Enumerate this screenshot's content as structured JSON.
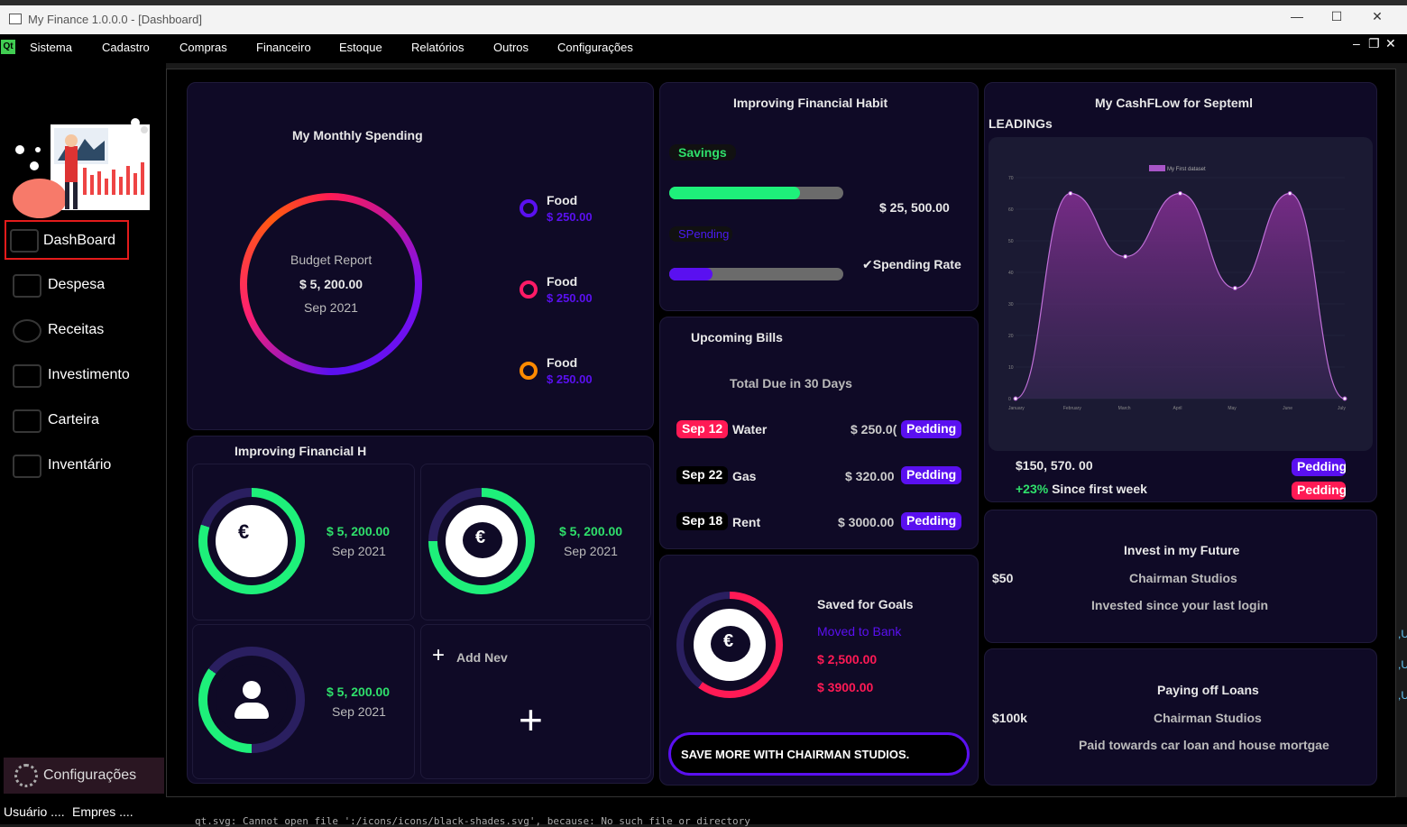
{
  "window": {
    "title": "My Finance 1.0.0.0 - [Dashboard]",
    "min": "—",
    "max": "☐",
    "close": "✕"
  },
  "menu": {
    "qt_badge": "Qt",
    "items": [
      "Sistema",
      "Cadastro",
      "Compras",
      "Financeiro",
      "Estoque",
      "Relatórios",
      "Outros",
      "Configurações"
    ],
    "mdi_buttons": [
      "–",
      "❐",
      "✕"
    ]
  },
  "sidebar": {
    "items": [
      {
        "label": "DashBoard",
        "icon": "dashboard-icon"
      },
      {
        "label": "Despesa",
        "icon": "expense-icon"
      },
      {
        "label": "Receitas",
        "icon": "income-icon"
      },
      {
        "label": "Investimento",
        "icon": "investment-icon"
      },
      {
        "label": "Carteira",
        "icon": "wallet-icon"
      },
      {
        "label": "Inventário",
        "icon": "inventory-icon"
      }
    ],
    "config_label": "Configurações"
  },
  "status": {
    "user": "Usuário ....",
    "company": "Empres ....",
    "console": "qt.svg: Cannot open file ':/icons/icons/black-shades.svg', because: No such file or directory"
  },
  "monthly_spending": {
    "title": "My Monthly Spending",
    "center_title": "Budget Report",
    "center_amount": "$ 5, 200.00",
    "center_date": "Sep 2021",
    "legend": [
      {
        "label": "Food",
        "amount": "$ 250.00",
        "color": "#5a10f0"
      },
      {
        "label": "Food",
        "amount": "$ 250.00",
        "color": "#ff1a66"
      },
      {
        "label": "Food",
        "amount": "$ 250.00",
        "color": "#ff8a00"
      }
    ]
  },
  "habit": {
    "title": "Improving Financial Habit",
    "savings_label": "Savings",
    "savings_progress": 0.75,
    "savings_amount": "$ 25, 500.00",
    "spending_label": "SPending",
    "spending_progress": 0.25,
    "spending_rate": "✔Spending Rate"
  },
  "cashflow": {
    "title": "My CashFLow for Septeml",
    "subtitle": "LEADINGs",
    "amount": "$150, 570. 00",
    "growth": "+23%",
    "growth_text": " Since first week",
    "badge1": "Pedding",
    "badge2": "Pedding"
  },
  "chart_data": {
    "type": "area",
    "legend": "My First dataset",
    "x": [
      "January",
      "February",
      "March",
      "April",
      "May",
      "June",
      "July"
    ],
    "series": [
      {
        "name": "My First dataset",
        "values": [
          0,
          65,
          45,
          65,
          35,
          65,
          0
        ]
      }
    ],
    "ylim": [
      0,
      70
    ],
    "yticks": [
      0,
      10,
      20,
      30,
      40,
      50,
      60,
      70
    ],
    "color": "#a855c7"
  },
  "improving_h": {
    "title": "Improving Financial H",
    "cards": [
      {
        "amount": "$ 5, 200.00",
        "date": "Sep 2021",
        "icon": "euro-hand-icon",
        "progress": 0.8
      },
      {
        "amount": "$ 5, 200.00",
        "date": "Sep 2021",
        "icon": "money-bag-icon",
        "progress": 0.75
      },
      {
        "amount": "$ 5, 200.00",
        "date": "Sep 2021",
        "icon": "user-icon",
        "progress": 0.35
      }
    ],
    "add_label": "Add Nev"
  },
  "bills": {
    "title": "Upcoming Bills",
    "subtitle": "Total Due in 30 Days",
    "items": [
      {
        "date": "Sep 12",
        "name": "Water",
        "amount": "$ 250.0(",
        "status": "Pedding",
        "date_color": "#ff1a55"
      },
      {
        "date": "Sep 22",
        "name": "Gas",
        "amount": "$ 320.00",
        "status": "Pedding",
        "date_color": "#000000"
      },
      {
        "date": "Sep 18",
        "name": "Rent",
        "amount": "$ 3000.00",
        "status": "Pedding",
        "date_color": "#000000"
      }
    ]
  },
  "goals": {
    "title": "Saved for Goals",
    "moved": "Moved to Bank",
    "amount1": "$ 2,500.00",
    "amount2": "$ 3900.00",
    "progress": 0.6,
    "cta": "SAVE MORE WITH CHAIRMAN STUDIOS."
  },
  "invest": {
    "title": "Invest in my Future",
    "amount": "$50",
    "company": "Chairman Studios",
    "note": "Invested since your last login"
  },
  "loans": {
    "title": "Paying off Loans",
    "amount": "$100k",
    "company": "Chairman Studios",
    "note": "Paid towards car loan and house mortgae"
  },
  "right_edge_marks": [
    ",U",
    ",U",
    ",U"
  ]
}
